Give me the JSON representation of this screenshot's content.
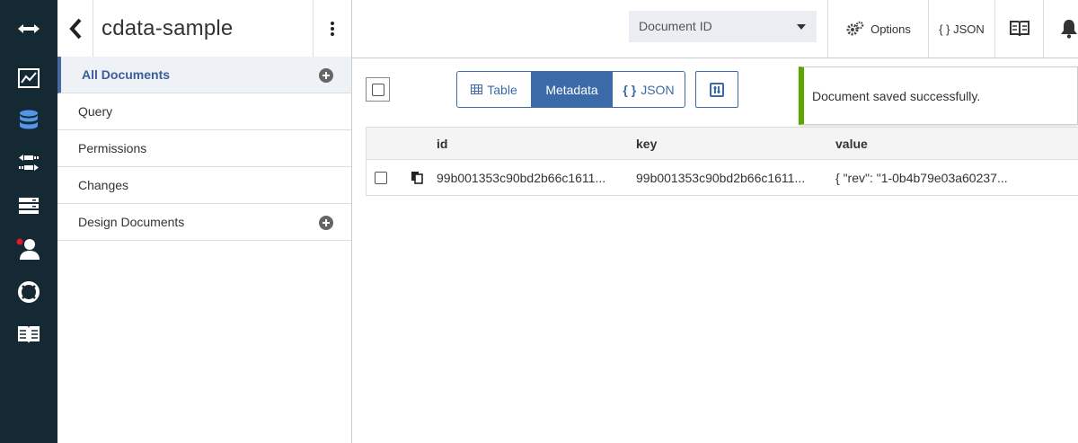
{
  "sidebar": {
    "db_name": "cdata-sample",
    "items": [
      {
        "label": "All Documents"
      },
      {
        "label": "Query"
      },
      {
        "label": "Permissions"
      },
      {
        "label": "Changes"
      },
      {
        "label": "Design Documents"
      }
    ]
  },
  "header": {
    "doc_id_select": "Document ID",
    "options_label": "Options",
    "json_label": "{ } JSON"
  },
  "toolbar": {
    "views": [
      {
        "label": "Table",
        "icon": "table-icon"
      },
      {
        "label": "Metadata"
      },
      {
        "label": "JSON",
        "icon": "braces-icon",
        "icon_text": "{ }"
      }
    ]
  },
  "toast": {
    "message": "Document saved successfully.",
    "color": "#5aa700"
  },
  "table": {
    "columns": [
      "id",
      "key",
      "value"
    ],
    "rows": [
      {
        "id": "99b001353c90bd2b66c1611...",
        "key": "99b001353c90bd2b66c1611...",
        "value": "{ \"rev\": \"1-0b4b79e03a60237..."
      }
    ]
  },
  "colors": {
    "rail": "#152935",
    "accent": "#3a6aa8",
    "active_db_icon": "#5596e6",
    "notification_dot": "#e0182d"
  }
}
